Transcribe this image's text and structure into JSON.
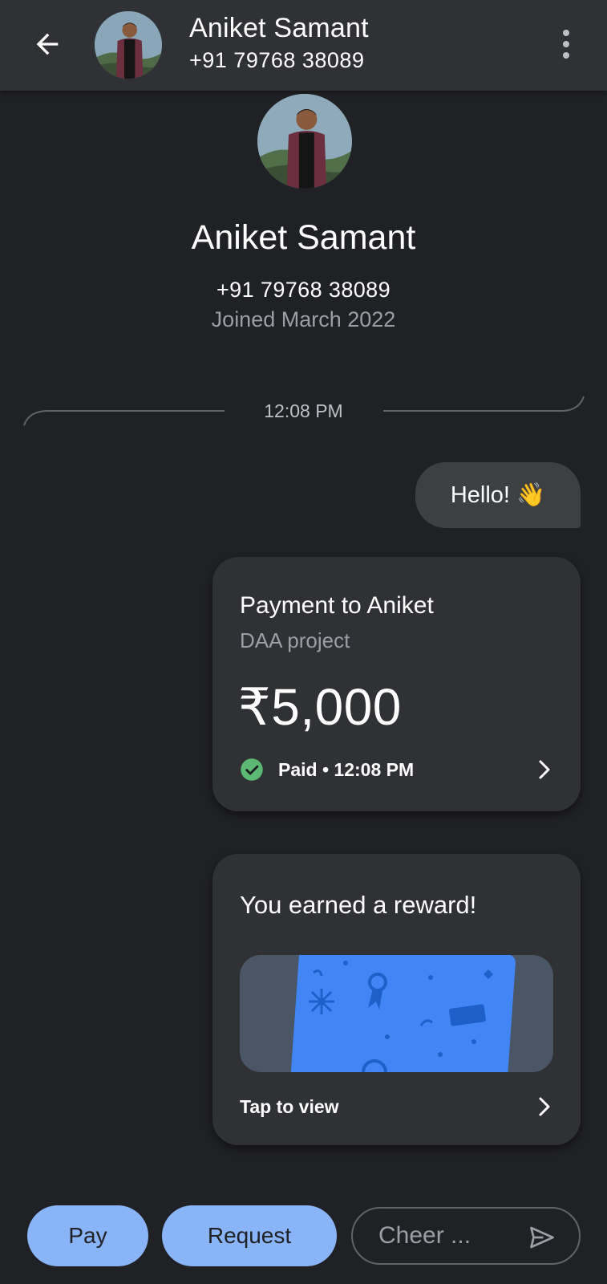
{
  "header": {
    "name": "Aniket Samant",
    "phone": "+91 79768 38089"
  },
  "profile": {
    "name": "Aniket Samant",
    "phone": "+91 79768 38089",
    "joined": "Joined March 2022"
  },
  "chat": {
    "divider_time": "12:08 PM",
    "hello_message": "Hello! 👋"
  },
  "payment_card": {
    "title": "Payment to Aniket",
    "note": "DAA project",
    "amount": "₹5,000",
    "status": "Paid • 12:08 PM",
    "status_color": "#34a853"
  },
  "reward_card": {
    "title": "You earned a reward!",
    "action": "Tap to view",
    "card_color": "#4285f4"
  },
  "actions": {
    "pay_label": "Pay",
    "request_label": "Request",
    "cheer_placeholder": "Cheer ..."
  },
  "colors": {
    "background": "#202124",
    "surface": "#303134",
    "accent": "#8ab4f8"
  }
}
